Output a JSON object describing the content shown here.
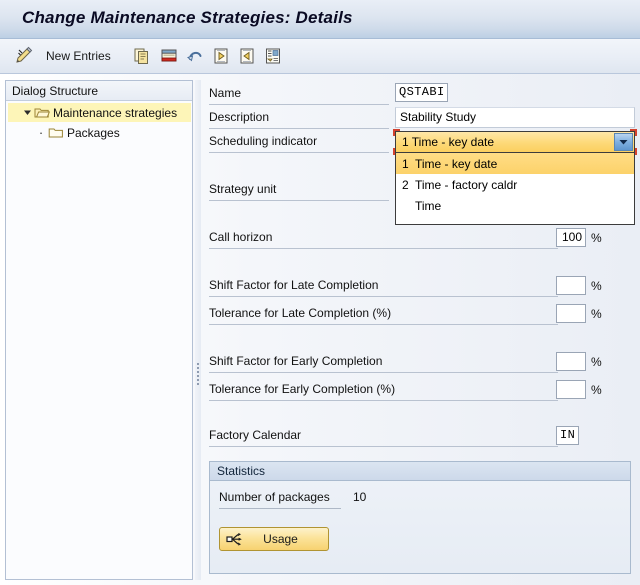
{
  "window": {
    "title": "Change Maintenance Strategies: Details"
  },
  "toolbar": {
    "edit_icon": "pencil-edit-icon",
    "new_entries_label": "New Entries",
    "buttons": [
      {
        "name": "copy-entry-button",
        "icon": "copy-icon"
      },
      {
        "name": "delete-entry-button",
        "icon": "delete-row-icon"
      },
      {
        "name": "undo-button",
        "icon": "undo-arrow-icon"
      },
      {
        "name": "previous-entry-button",
        "icon": "previous-page-icon"
      },
      {
        "name": "next-entry-button",
        "icon": "next-page-icon"
      },
      {
        "name": "details-button",
        "icon": "details-list-icon"
      }
    ]
  },
  "sidebar": {
    "header": "Dialog Structure",
    "items": [
      {
        "label": "Maintenance strategies",
        "icon": "open-folder-icon",
        "toggle": "expanded-triangle-icon",
        "selected": true
      },
      {
        "label": "Packages",
        "icon": "closed-folder-icon",
        "toggle": "bullet-icon",
        "selected": false
      }
    ]
  },
  "form": {
    "name_label": "Name",
    "name_value": "QSTABI",
    "description_label": "Description",
    "description_value": "Stability Study",
    "scheduling_label": "Scheduling indicator",
    "scheduling_value": "1 Time - key date",
    "scheduling_options": [
      {
        "key": "1",
        "text": "Time - key date",
        "selected": true
      },
      {
        "key": "2",
        "text": "Time - factory caldr",
        "selected": false
      },
      {
        "key": "",
        "text": "Time",
        "selected": false
      }
    ],
    "strategy_unit_label": "Strategy unit",
    "strategy_unit_value": "",
    "call_horizon_label": "Call horizon",
    "call_horizon_value": "100",
    "call_horizon_unit": "%",
    "shift_late_label": "Shift Factor for Late Completion",
    "shift_late_value": "",
    "shift_late_unit": "%",
    "tolerance_late_label": "Tolerance for Late Completion (%)",
    "tolerance_late_value": "",
    "tolerance_late_unit": "%",
    "shift_early_label": "Shift Factor for Early Completion",
    "shift_early_value": "",
    "shift_early_unit": "%",
    "tolerance_early_label": "Tolerance for Early Completion (%)",
    "tolerance_early_value": "",
    "tolerance_early_unit": "%",
    "factory_calendar_label": "Factory Calendar",
    "factory_calendar_value": "IN"
  },
  "statistics": {
    "title": "Statistics",
    "packages_label": "Number of packages",
    "packages_value": "10",
    "usage_button_label": "Usage",
    "usage_button_icon": "usage-network-icon"
  },
  "colors": {
    "title_bar": "#cfdbea",
    "selection_yellow": "#fdf5b8",
    "combo_highlight": "#fcd26a",
    "focus_red": "#d3422e",
    "button_yellow": "#f7d270",
    "panel_blue": "#cdd9ea"
  }
}
